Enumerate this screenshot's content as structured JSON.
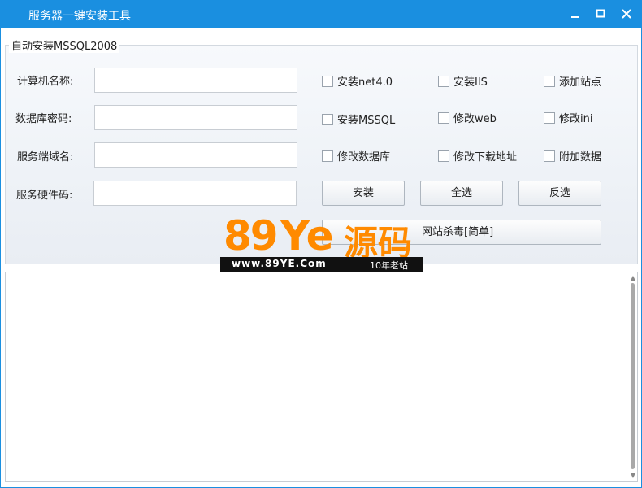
{
  "window": {
    "title": "服务器一键安装工具",
    "minimize_icon": "minimize-icon",
    "maximize_icon": "maximize-icon",
    "close_icon": "close-icon",
    "accent_color": "#1a8fe0"
  },
  "group": {
    "title": "自动安装MSSQL2008",
    "fields": [
      {
        "label": "计算机名称:",
        "value": ""
      },
      {
        "label": "数据库密码:",
        "value": ""
      },
      {
        "label": "服务端域名:",
        "value": ""
      },
      {
        "label": "服务硬件码:",
        "value": ""
      }
    ],
    "checkboxes": [
      {
        "label": "安装net4.0",
        "checked": false
      },
      {
        "label": "安装IIS",
        "checked": false
      },
      {
        "label": "添加站点",
        "checked": false
      },
      {
        "label": "安装MSSQL",
        "checked": false
      },
      {
        "label": "修改web",
        "checked": false
      },
      {
        "label": "修改ini",
        "checked": false
      },
      {
        "label": "修改数据库",
        "checked": false
      },
      {
        "label": "修改下载地址",
        "checked": false
      },
      {
        "label": "附加数据",
        "checked": false
      }
    ],
    "buttons": {
      "install": "安装",
      "select_all": "全选",
      "invert": "反选",
      "scan": "网站杀毒[简单]"
    }
  },
  "watermark": {
    "digits": "89",
    "letters": "Ye",
    "chinese": "源码",
    "url": "www.89YE.Com",
    "slogan": "10年老站"
  },
  "output": {
    "text": ""
  }
}
